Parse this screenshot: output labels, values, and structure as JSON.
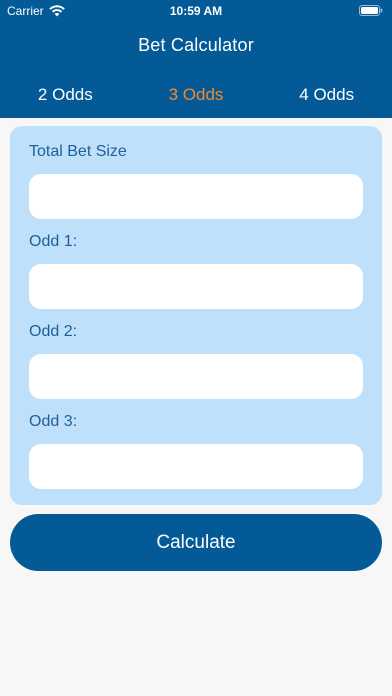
{
  "status_bar": {
    "carrier": "Carrier",
    "time": "10:59 AM",
    "icons": [
      "wifi-icon",
      "battery-icon"
    ]
  },
  "header": {
    "title": "Bet Calculator"
  },
  "tabs": [
    {
      "label": "2 Odds",
      "active": false
    },
    {
      "label": "3 Odds",
      "active": true
    },
    {
      "label": "4 Odds",
      "active": false
    }
  ],
  "form": {
    "fields": [
      {
        "label": "Total Bet Size",
        "value": "",
        "placeholder": ""
      },
      {
        "label": "Odd 1:",
        "value": "",
        "placeholder": ""
      },
      {
        "label": "Odd 2:",
        "value": "",
        "placeholder": ""
      },
      {
        "label": "Odd 3:",
        "value": "",
        "placeholder": ""
      }
    ]
  },
  "calculate_button": {
    "label": "Calculate"
  },
  "colors": {
    "primary": "#035a96",
    "accent_active_tab": "#f08a2d",
    "card_background": "#bfe0fb",
    "label_text": "#1f5f96",
    "page_background": "#f7f7f7"
  }
}
